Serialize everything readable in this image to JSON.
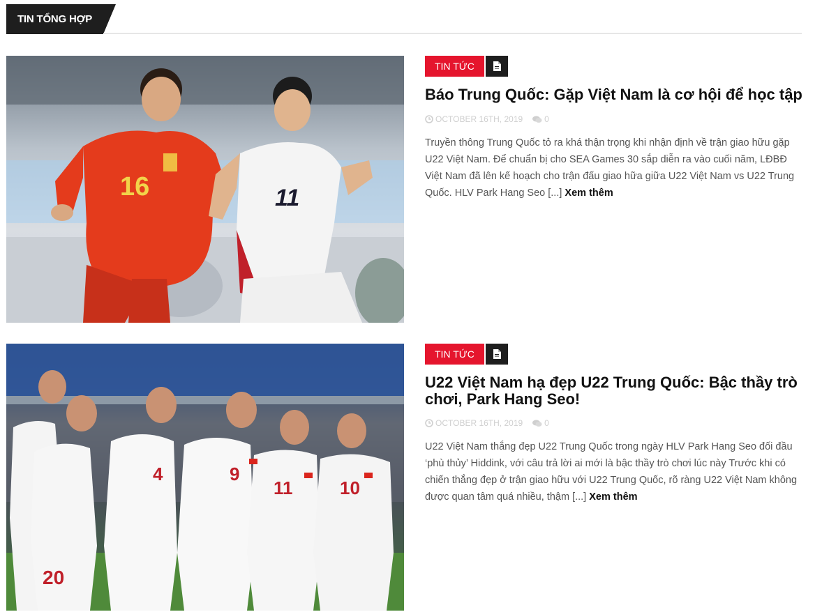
{
  "section": {
    "title": "TIN TỔNG HỢP"
  },
  "posts": [
    {
      "category": "TIN TỨC",
      "format_icon": "document-icon",
      "title": "Báo Trung Quốc: Gặp Việt Nam là cơ hội để học tập",
      "date": "OCTOBER 16TH, 2019",
      "comments": "0",
      "excerpt": "Truyền thông Trung Quốc tỏ ra khá thận trọng khi nhận định về trận giao hữu gặp U22 Việt Nam. Để chuẩn bị cho SEA Games 30 sắp diễn ra vào cuối năm, LĐBĐ Việt Nam đã lên kế hoạch cho trận đấu giao hữa giữa U22 Việt Nam vs U22 Trung Quốc. HLV Park Hang Seo [...]",
      "read_more": "Xem thêm",
      "image_numbers": [
        "16",
        "11"
      ]
    },
    {
      "category": "TIN TỨC",
      "format_icon": "document-icon",
      "title": "U22 Việt Nam hạ đẹp U22 Trung Quốc: Bậc thầy trò chơi, Park Hang Seo!",
      "date": "OCTOBER 16TH, 2019",
      "comments": "0",
      "excerpt": "U22 Việt Nam thắng đẹp U22 Trung Quốc trong ngày HLV Park Hang Seo đối đầu ‘phù thủy’ Hiddink, với câu trả lời ai mới là bậc thầy trò chơi lúc này Trước khi có chiến thắng đẹp ở trận giao hữu với U22 Trung Quốc, rõ ràng U22 Việt Nam không được quan tâm quá nhiều, thậm [...]",
      "read_more": "Xem thêm",
      "image_numbers": [
        "20",
        "4",
        "9",
        "11",
        "10"
      ]
    }
  ],
  "colors": {
    "accent": "#e5152d",
    "dark": "#1e1e1e",
    "meta": "#cfcfcf",
    "china_red": "#e43b1c",
    "vn_white": "#f4f4f4"
  }
}
